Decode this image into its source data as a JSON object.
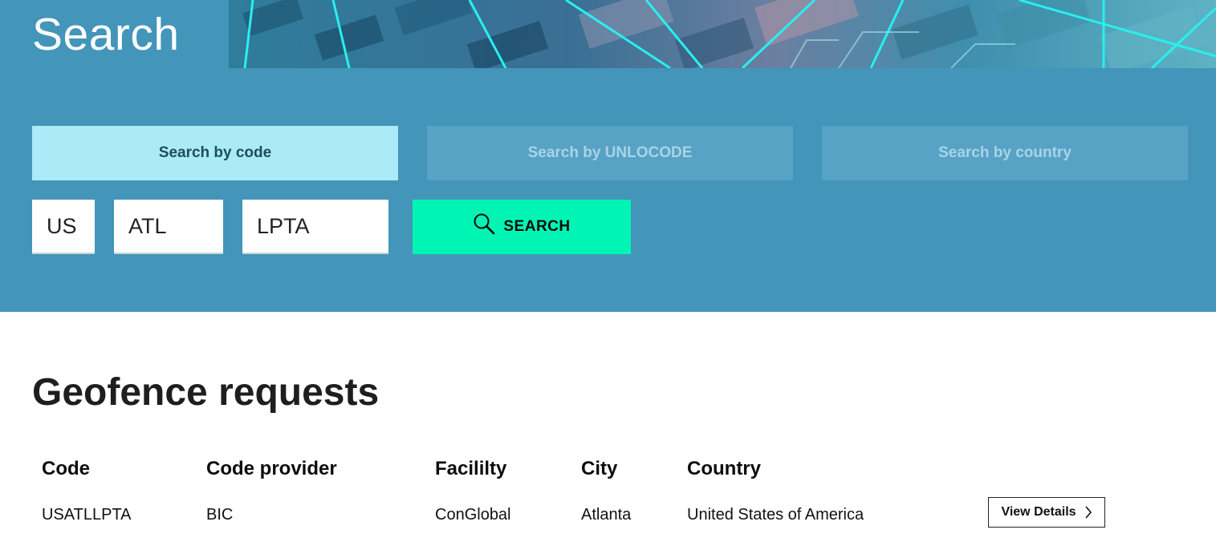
{
  "header": {
    "title": "Search"
  },
  "tabs": [
    {
      "label": "Search by code",
      "active": true
    },
    {
      "label": "Search by UNLOCODE",
      "active": false
    },
    {
      "label": "Search by country",
      "active": false
    }
  ],
  "search_form": {
    "country_code": "US",
    "location_code": "ATL",
    "facility_code": "LPTA",
    "search_label": "SEARCH",
    "search_icon": "search-icon"
  },
  "results": {
    "title": "Geofence requests",
    "columns": [
      "Code",
      "Code provider",
      "Facililty",
      "City",
      "Country"
    ],
    "rows": [
      {
        "code": "USATLLPTA",
        "code_provider": "BIC",
        "facility": "ConGlobal",
        "city": "Atlanta",
        "country": "United States of America",
        "action_label": "View Details"
      }
    ]
  },
  "colors": {
    "hero_background": "#4395ba",
    "active_tab": "#aaebf7",
    "inactive_tab": "#57a2c5",
    "search_button": "#00f5b4"
  }
}
